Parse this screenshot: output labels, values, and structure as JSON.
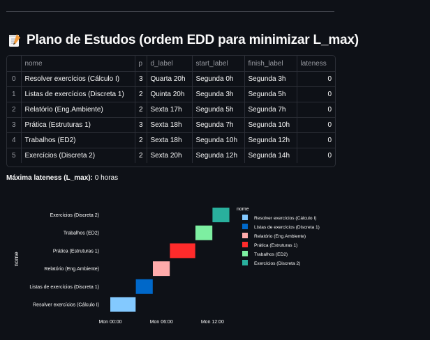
{
  "page": {
    "title": "Plano de Estudos (ordem EDD para minimizar L_max)",
    "title_icon": "memo-icon"
  },
  "table": {
    "columns": [
      "",
      "nome",
      "p",
      "d_label",
      "start_label",
      "finish_label",
      "lateness"
    ],
    "rows": [
      {
        "index": "0",
        "nome": "Resolver exercícios (Cálculo I)",
        "p": "3",
        "d_label": "Quarta 20h",
        "start_label": "Segunda 0h",
        "finish_label": "Segunda 3h",
        "lateness": "0"
      },
      {
        "index": "1",
        "nome": "Listas de exercícios (Discreta 1)",
        "p": "2",
        "d_label": "Quinta 20h",
        "start_label": "Segunda 3h",
        "finish_label": "Segunda 5h",
        "lateness": "0"
      },
      {
        "index": "2",
        "nome": "Relatório (Eng.Ambiente)",
        "p": "2",
        "d_label": "Sexta 17h",
        "start_label": "Segunda 5h",
        "finish_label": "Segunda 7h",
        "lateness": "0"
      },
      {
        "index": "3",
        "nome": "Prática (Estruturas 1)",
        "p": "3",
        "d_label": "Sexta 18h",
        "start_label": "Segunda 7h",
        "finish_label": "Segunda 10h",
        "lateness": "0"
      },
      {
        "index": "4",
        "nome": "Trabalhos (ED2)",
        "p": "2",
        "d_label": "Sexta 18h",
        "start_label": "Segunda 10h",
        "finish_label": "Segunda 12h",
        "lateness": "0"
      },
      {
        "index": "5",
        "nome": "Exercícios (Discreta 2)",
        "p": "2",
        "d_label": "Sexta 20h",
        "start_label": "Segunda 12h",
        "finish_label": "Segunda 14h",
        "lateness": "0"
      }
    ]
  },
  "summary": {
    "label": "Máxima lateness (L_max):",
    "value": " 0 horas"
  },
  "chart_data": {
    "type": "bar",
    "orientation": "horizontal-timeline",
    "ylabel": "nome",
    "xlabel": "",
    "x_ticks": [
      {
        "label": "Mon 00:00",
        "hour": 0
      },
      {
        "label": "Mon 06:00",
        "hour": 6
      },
      {
        "label": "Mon 12:00",
        "hour": 12
      }
    ],
    "legend_title": "nome",
    "legend_position": "right",
    "tasks": [
      {
        "name": "Resolver exercícios (Cálculo I)",
        "start": 0,
        "finish": 3,
        "color": "#83c9ff"
      },
      {
        "name": "Listas de exercícios (Discreta 1)",
        "start": 3,
        "finish": 5,
        "color": "#0068c9"
      },
      {
        "name": "Relatório (Eng.Ambiente)",
        "start": 5,
        "finish": 7,
        "color": "#ffabab"
      },
      {
        "name": "Prática (Estruturas 1)",
        "start": 7,
        "finish": 10,
        "color": "#ff2b2b"
      },
      {
        "name": "Trabalhos (ED2)",
        "start": 10,
        "finish": 12,
        "color": "#7defa1"
      },
      {
        "name": "Exercícios (Discreta 2)",
        "start": 12,
        "finish": 14,
        "color": "#29b09d"
      }
    ]
  }
}
